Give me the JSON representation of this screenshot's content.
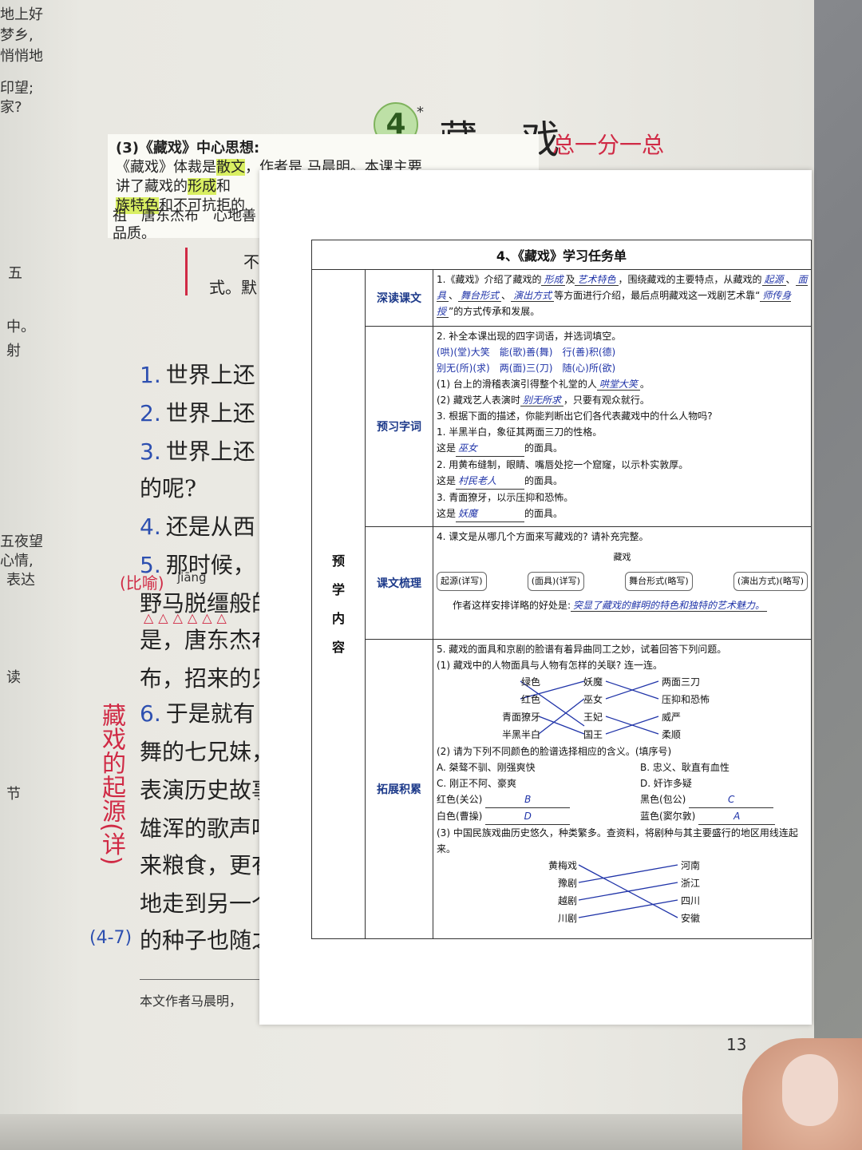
{
  "book": {
    "lesson_number": "4",
    "lesson_mark": "*",
    "lesson_title": "藏 戏",
    "handwritten_structure": "总一分一总",
    "sticky": {
      "heading": "(3)《藏戏》中心思想:",
      "line1_a": "《藏戏》体裁是",
      "line1_b": "散文",
      "line1_c": "，作者是",
      "line1_d": "马晨明",
      "line1_e": "。本课主要",
      "line2_a": "讲了藏戏的",
      "line2_b": "形成",
      "line2_c": "和",
      "line3_a": "族特色",
      "line3_b": "和不可抗拒的",
      "line4": "祖　唐东杰布　心地善",
      "line5": "品质。"
    },
    "body_lines": [
      {
        "num": "",
        "text": "不"
      },
      {
        "num": "",
        "text": "式。默"
      },
      {
        "num": "1.",
        "text": "世界上还"
      },
      {
        "num": "2.",
        "text": "世界上还"
      },
      {
        "num": "3.",
        "text": "世界上还"
      },
      {
        "num": "",
        "text": "的呢?"
      },
      {
        "num": "4.",
        "text": "还是从西"
      },
      {
        "num": "5.",
        "text": "那时候，"
      },
      {
        "num": "",
        "text": "野马脱缰般的"
      },
      {
        "num": "",
        "text": "是，唐东杰布"
      },
      {
        "num": "",
        "text": "布，招来的只"
      },
      {
        "num": "6.",
        "text": "于是就有"
      },
      {
        "num": "",
        "text": "舞的七兄妹，"
      },
      {
        "num": "",
        "text": "表演历史故事"
      },
      {
        "num": "",
        "text": "雄浑的歌声响"
      },
      {
        "num": "",
        "text": "来粮食，更有"
      },
      {
        "num": "",
        "text": "地走到另一个"
      },
      {
        "num": "",
        "text": "的种子也随之"
      }
    ],
    "pinyin": "jiāng",
    "margin_note_left": "(比喻)",
    "vertical_note": "藏戏的起源(详)",
    "range_note": "(4-7)",
    "left_scraps": [
      "地上好",
      "梦乡,",
      "悄悄地",
      "印望;",
      "家?",
      "五",
      "中。",
      "射",
      "五夜望",
      "心情,",
      "表达",
      "读",
      "节"
    ],
    "footnote": "本文作者马晨明，",
    "page_number": "13"
  },
  "worksheet": {
    "title": "4、《藏戏》学习任务单",
    "side_label": [
      "预",
      "学",
      "内",
      "容"
    ],
    "sections": [
      {
        "name": "深读课文",
        "text_a": "1.《藏戏》介绍了藏戏的",
        "fill_1": "形成",
        "text_b": "及",
        "fill_2": "艺术特色",
        "text_c": "，围绕藏戏的主要特点，从藏戏的",
        "fill_3": "起源",
        "fill_4": "面具",
        "fill_5": "舞台形式",
        "fill_6": "演出方式",
        "text_d": "等方面进行介绍，最后点明藏戏这一戏剧艺术靠“",
        "fill_7": "师传身授",
        "text_e": "”的方式传承和发展。"
      },
      {
        "name": "预习字词",
        "q2": "2. 补全本课出现的四字词语，并选词填空。",
        "idioms_row1": "(哄)(堂)大笑　能(歌)善(舞)　行(善)积(德)",
        "idioms_row2": "别无(所)(求)　两(面)三(刀)　随(心)所(欲)",
        "q2_1_a": "(1) 台上的滑稽表演引得整个礼堂的人",
        "q2_1_fill": "哄堂大笑",
        "q2_1_b": "。",
        "q2_2_a": "(2) 藏戏艺人表演时",
        "q2_2_fill": "别无所求",
        "q2_2_b": "，只要有观众就行。",
        "q3": "3. 根据下面的描述，你能判断出它们各代表藏戏中的什么人物吗?",
        "q3_1": "1. 半黑半白，象征其两面三刀的性格。",
        "q3_1_ans": "巫女",
        "q3_2": "2. 用黄布缝制，眼睛、嘴唇处挖一个窟窿，以示朴实敦厚。",
        "q3_2_ans": "村民老人",
        "q3_3": "3. 青面獠牙，以示压抑和恐怖。",
        "q3_3_ans": "妖魔",
        "this_is": "这是",
        "mask_of": "的面具。"
      },
      {
        "name": "课文梳理",
        "q4": "4. 课文是从哪几个方面来写藏戏的? 请补充完整。",
        "center": "藏戏",
        "box1": "起源(详写)",
        "box2": "(面具)(详写)",
        "box3": "舞台形式(略写)",
        "box4": "(演出方式)(略写)",
        "q4b_a": "作者这样安排详略的好处是:",
        "q4b_fill": "突显了藏戏的鲜明的特色和独特的艺术魅力。"
      },
      {
        "name": "拓展积累",
        "q5": "5. 藏戏的面具和京剧的脸谱有着异曲同工之妙，试着回答下列问题。",
        "q5_1": "(1) 藏戏中的人物面具与人物有怎样的关联? 连一连。",
        "col1": [
          "绿色",
          "红色",
          "青面獠牙",
          "半黑半白"
        ],
        "col2": [
          "妖魔",
          "巫女",
          "王妃",
          "国王"
        ],
        "col3": [
          "两面三刀",
          "压抑和恐怖",
          "威严",
          "柔顺"
        ],
        "q5_2": "(2) 请为下列不同颜色的脸谱选择相应的含义。(填序号)",
        "opt_a": "A. 桀骜不驯、刚强爽快",
        "opt_b": "B. 忠义、耿直有血性",
        "opt_c": "C. 刚正不阿、豪爽",
        "opt_d": "D. 奸诈多疑",
        "red": "红色(关公)",
        "red_ans": "B",
        "black": "黑色(包公)",
        "black_ans": "C",
        "white": "白色(曹操)",
        "white_ans": "D",
        "blue": "蓝色(窦尔敦)",
        "blue_ans": "A",
        "q5_3": "(3) 中国民族戏曲历史悠久，种类繁多。查资料，将剧种与其主要盛行的地区用线连起来。",
        "operas": [
          "黄梅戏",
          "豫剧",
          "越剧",
          "川剧"
        ],
        "regions": [
          "河南",
          "浙江",
          "四川",
          "安徽"
        ]
      }
    ]
  }
}
